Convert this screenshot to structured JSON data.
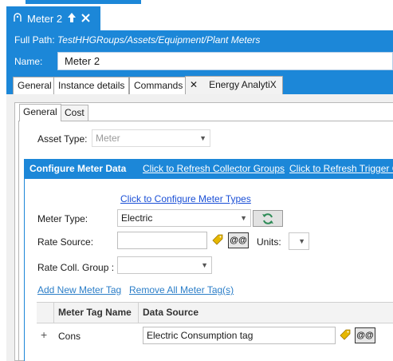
{
  "doc_tab": {
    "title": "Meter 2"
  },
  "header": {
    "full_path_label": "Full Path:",
    "full_path_value": "TestHHGRoups/Assets/Equipment/Plant Meters",
    "name_label": "Name:",
    "name_value": "Meter 2"
  },
  "tabs": {
    "general": "General",
    "instance_details": "Instance details",
    "commands": "Commands",
    "energy": "Energy AnalytiX",
    "energy_close": "✕"
  },
  "subtabs": {
    "general": "General",
    "cost": "Cost"
  },
  "asset_type": {
    "label": "Asset Type:",
    "value": "Meter"
  },
  "configure": {
    "title": "Configure Meter Data",
    "refresh_collector": "Click to Refresh Collector Groups",
    "refresh_trigger": "Click to Refresh Trigger G",
    "configure_types_link": "Click to Configure Meter Types"
  },
  "meter_type": {
    "label": "Meter Type:",
    "value": "Electric"
  },
  "rate_source": {
    "label": "Rate Source:",
    "value": "",
    "at_label": "@@"
  },
  "units": {
    "label": "Units:",
    "value": ""
  },
  "rate_coll_group": {
    "label": "Rate Coll. Group :",
    "value": ""
  },
  "tag_actions": {
    "add": "Add New Meter Tag",
    "remove": "Remove All Meter Tag(s)"
  },
  "grid": {
    "headers": [
      "Meter Tag Name",
      "Data Source"
    ],
    "rows": [
      {
        "expander": "+",
        "name": "Cons",
        "source": "Electric Consumption tag",
        "at_label": "@@"
      }
    ]
  },
  "colors": {
    "accent": "#1c87d8",
    "link": "#1a4fd6"
  }
}
